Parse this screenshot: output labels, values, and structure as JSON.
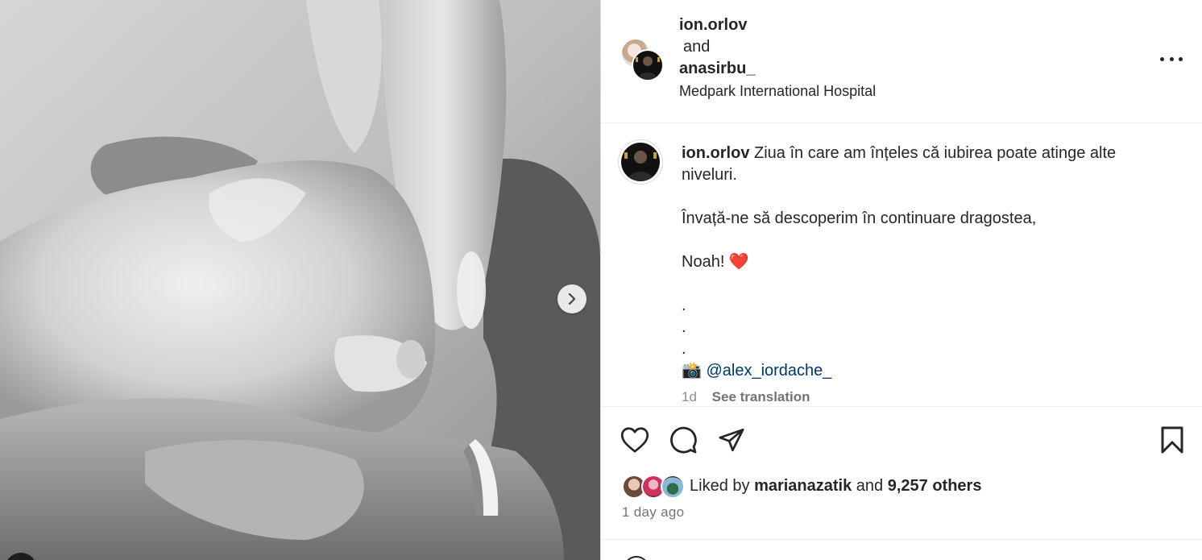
{
  "post": {
    "header": {
      "user1": "ion.orlov",
      "conjunction": "and",
      "user2": "anasirbu_",
      "location": "Medpark International Hospital"
    },
    "caption": {
      "username": "ion.orlov",
      "line1": " Ziua în care am înțeles că iubirea poate atinge alte niveluri.",
      "line2": "Învață-ne să descoperim în continuare dragostea,",
      "line3": "Noah! ❤️",
      "dot1": ".",
      "dot2": ".",
      "dot3": ".",
      "credit_emoji": "📸",
      "mention": "@alex_iordache_",
      "age": "1d",
      "translate_label": "See translation"
    },
    "likes": {
      "prefix": "Liked by",
      "user": "marianazatik",
      "connector": "and",
      "others": "9,257 others"
    },
    "timestamp": "1 day ago"
  },
  "colors": {
    "mention": "#00376b",
    "secondary_text": "#737373",
    "divider": "#efefef"
  },
  "icons": {
    "like": "heart-icon",
    "comment": "comment-bubble-icon",
    "share": "paper-plane-icon",
    "save": "bookmark-icon",
    "more": "more-horizontal-icon",
    "next": "chevron-right-icon"
  }
}
